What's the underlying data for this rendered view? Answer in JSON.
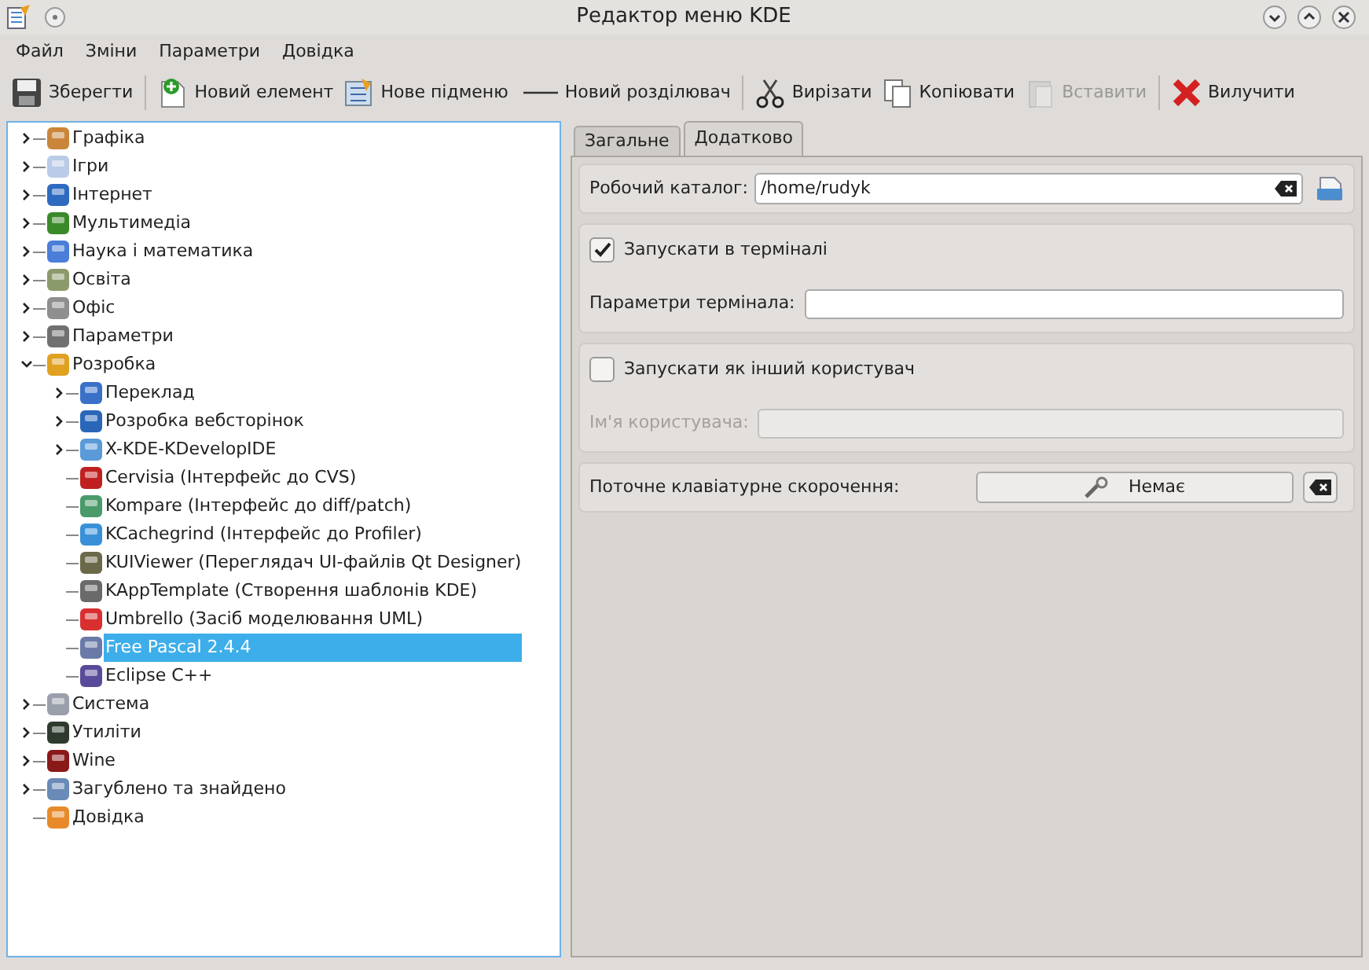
{
  "window": {
    "title": "Редактор меню KDE"
  },
  "menu": [
    "Файл",
    "Зміни",
    "Параметри",
    "Довідка"
  ],
  "toolbar": [
    {
      "kind": "save",
      "label": "Зберегти",
      "disabled": false
    },
    {
      "kind": "sep"
    },
    {
      "kind": "new-item",
      "label": "Новий елемент",
      "disabled": false
    },
    {
      "kind": "new-submenu",
      "label": "Нове підменю",
      "disabled": false
    },
    {
      "kind": "new-separator",
      "label": "Новий розділювач",
      "disabled": false
    },
    {
      "kind": "sep"
    },
    {
      "kind": "cut",
      "label": "Вирізати",
      "disabled": false
    },
    {
      "kind": "copy",
      "label": "Копіювати",
      "disabled": false
    },
    {
      "kind": "paste",
      "label": "Вставити",
      "disabled": true
    },
    {
      "kind": "sep"
    },
    {
      "kind": "delete",
      "label": "Вилучити",
      "disabled": false
    }
  ],
  "tree": [
    {
      "label": "Графіка",
      "expanded": false,
      "selected": false
    },
    {
      "label": "Ігри",
      "expanded": false,
      "selected": false
    },
    {
      "label": "Інтернет",
      "expanded": false,
      "selected": false
    },
    {
      "label": "Мультимедіа",
      "expanded": false,
      "selected": false
    },
    {
      "label": "Наука і математика",
      "expanded": false,
      "selected": false
    },
    {
      "label": "Освіта",
      "expanded": false,
      "selected": false
    },
    {
      "label": "Офіс",
      "expanded": false,
      "selected": false
    },
    {
      "label": "Параметри",
      "expanded": false,
      "selected": false
    },
    {
      "label": "Розробка",
      "expanded": true,
      "selected": false,
      "children": [
        {
          "label": "Переклад",
          "expanded": false,
          "selected": false
        },
        {
          "label": "Розробка вебсторінок",
          "expanded": false,
          "selected": false
        },
        {
          "label": "X-KDE-KDevelopIDE",
          "expanded": false,
          "selected": false
        },
        {
          "label": "Cervisia (Інтерфейс до CVS)",
          "selected": false
        },
        {
          "label": "Kompare (Інтерфейс до diff/patch)",
          "selected": false
        },
        {
          "label": "KCachegrind (Інтерфейс до Profiler)",
          "selected": false
        },
        {
          "label": "KUIViewer (Переглядач UI-файлів Qt Designer)",
          "selected": false
        },
        {
          "label": "KAppTemplate (Створення шаблонів KDE)",
          "selected": false
        },
        {
          "label": "Umbrello (Засіб моделювання UML)",
          "selected": false
        },
        {
          "label": "Free Pascal 2.4.4",
          "selected": true
        },
        {
          "label": "Eclipse C++",
          "selected": false
        }
      ]
    },
    {
      "label": "Система",
      "expanded": false,
      "selected": false
    },
    {
      "label": "Утиліти",
      "expanded": false,
      "selected": false
    },
    {
      "label": "Wine",
      "expanded": false,
      "selected": false
    },
    {
      "label": "Загублено та знайдено",
      "expanded": false,
      "selected": false
    },
    {
      "label": "Довідка",
      "selected": false
    }
  ],
  "tabs": [
    {
      "label": "Загальне",
      "selected": false
    },
    {
      "label": "Додатково",
      "selected": true
    }
  ],
  "work_dir": {
    "label": "Робочий каталог:",
    "value": "/home/rudyk"
  },
  "terminal": {
    "label": "Запускати в терміналі",
    "checked": true,
    "options_label": "Параметри термінала:",
    "options_disabled": false
  },
  "other_user": {
    "label": "Запускати як інший користувач",
    "checked": false,
    "username_label": "Ім'я користувача:",
    "username_disabled": true
  },
  "shortcut": {
    "label": "Поточне клавіатурне скорочення:",
    "value": "Немає"
  }
}
